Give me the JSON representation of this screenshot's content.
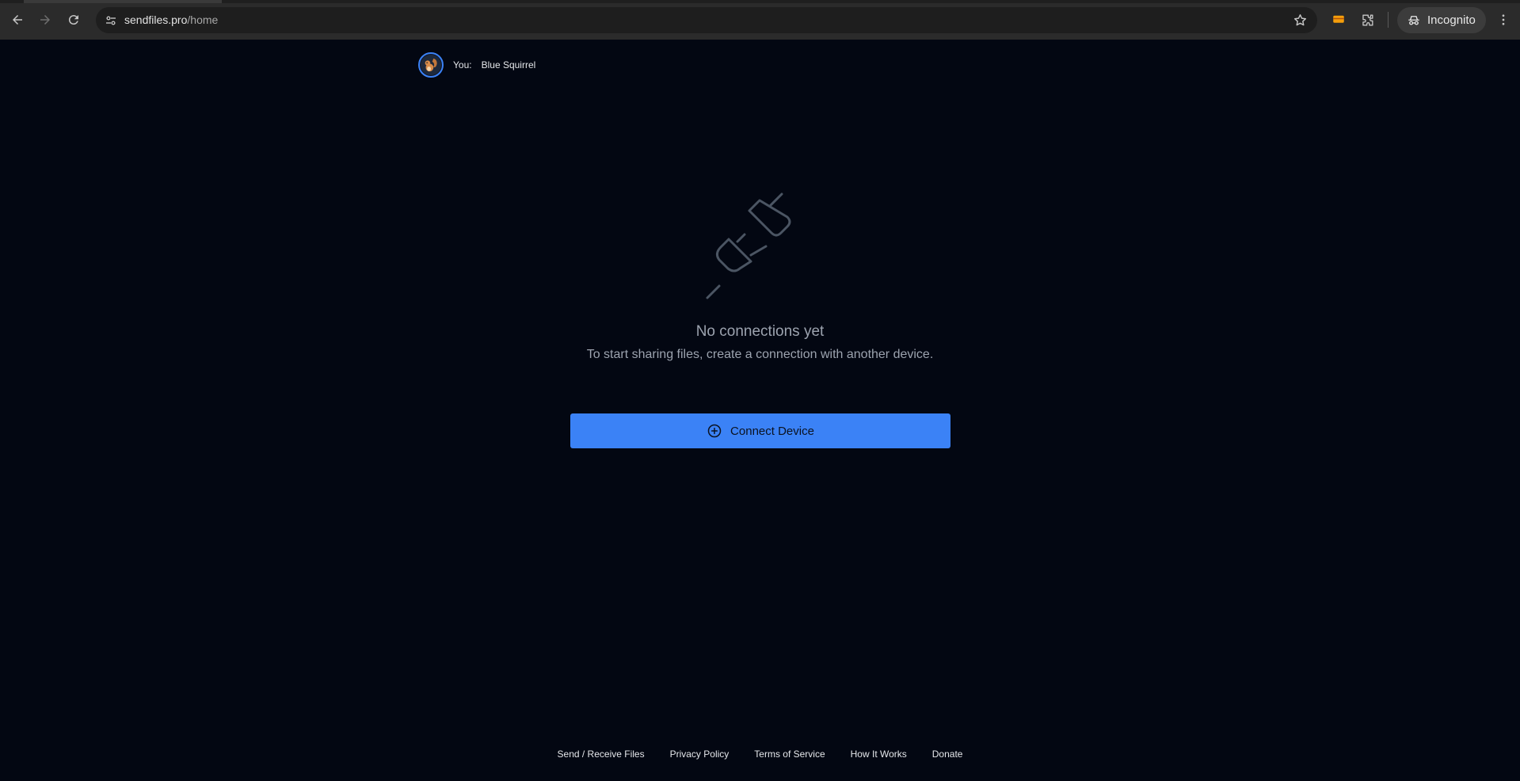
{
  "browser": {
    "url_host": "sendfiles.pro",
    "url_path": "/home",
    "incognito_label": "Incognito",
    "icons": {
      "back": "back-arrow-icon",
      "forward": "forward-arrow-icon",
      "reload": "reload-icon",
      "site_info": "tune-icon",
      "bookmark": "star-icon",
      "extension_1": "orange-extension-icon",
      "extensions": "puzzle-icon",
      "incognito": "incognito-icon",
      "menu": "kebab-menu-icon"
    }
  },
  "header": {
    "you_label": "You:",
    "device_name": "Blue Squirrel",
    "avatar_icon": "squirrel-icon"
  },
  "empty_state": {
    "icon": "disconnected-plug-icon",
    "title": "No connections yet",
    "subtitle": "To start sharing files, create a connection with another device."
  },
  "actions": {
    "connect_label": "Connect Device",
    "connect_icon": "plus-circle-icon"
  },
  "footer": {
    "links": [
      "Send / Receive Files",
      "Privacy Policy",
      "Terms of Service",
      "How It Works",
      "Donate"
    ]
  },
  "colors": {
    "page_bg": "#030712",
    "accent": "#3b82f6",
    "muted_text": "#9ca3af",
    "chrome_bg": "#2b2b2b"
  }
}
